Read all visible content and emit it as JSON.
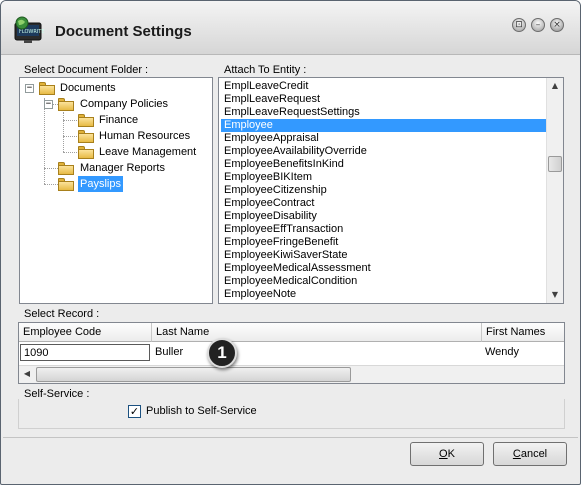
{
  "window": {
    "title": "Document Settings",
    "icon": "monitor-globe-icon",
    "controls": {
      "maximize": "⊡",
      "minimize": "–",
      "close": "×"
    }
  },
  "folder_group": {
    "label": "Select Document Folder :",
    "items": [
      {
        "label": "Documents",
        "level": 0,
        "expander": "−"
      },
      {
        "label": "Company Policies",
        "level": 1,
        "expander": "−"
      },
      {
        "label": "Finance",
        "level": 2
      },
      {
        "label": "Human Resources",
        "level": 2
      },
      {
        "label": "Leave Management",
        "level": 2
      },
      {
        "label": "Manager Reports",
        "level": 1
      },
      {
        "label": "Payslips",
        "level": 1,
        "selected": true
      }
    ]
  },
  "entity_group": {
    "label": "Attach To Entity :",
    "items": [
      "EmplLeaveCredit",
      "EmplLeaveRequest",
      "EmplLeaveRequestSettings",
      "Employee",
      "EmployeeAppraisal",
      "EmployeeAvailabilityOverride",
      "EmployeeBenefitsInKind",
      "EmployeeBIKItem",
      "EmployeeCitizenship",
      "EmployeeContract",
      "EmployeeDisability",
      "EmployeeEffTransaction",
      "EmployeeFringeBenefit",
      "EmployeeKiwiSaverState",
      "EmployeeMedicalAssessment",
      "EmployeeMedicalCondition",
      "EmployeeNote"
    ],
    "selected_index": 3
  },
  "record_group": {
    "label": "Select Record :",
    "columns": [
      "Employee Code",
      "Last Name",
      "First Names"
    ],
    "row": {
      "code": "1090",
      "last_name": "Buller",
      "first_names": "Wendy"
    }
  },
  "callout": "1",
  "self_service": {
    "label": "Self-Service :",
    "checkbox_label": "Publish to Self-Service",
    "checked": true,
    "check_glyph": "✓"
  },
  "buttons": {
    "ok": "OK",
    "cancel": "Cancel"
  },
  "scroll_glyphs": {
    "up": "▲",
    "down": "▼",
    "left": "◀",
    "right": "▶"
  }
}
